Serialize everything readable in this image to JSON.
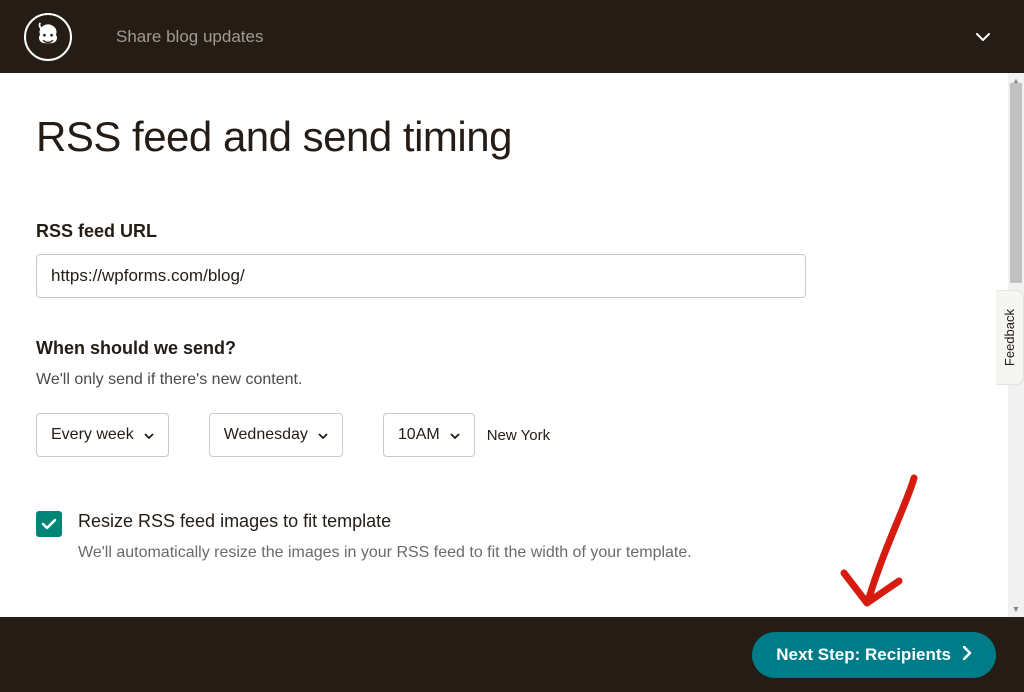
{
  "header": {
    "title": "Share blog updates"
  },
  "page": {
    "heading": "RSS feed and send timing"
  },
  "rss_url": {
    "label": "RSS feed URL",
    "value": "https://wpforms.com/blog/"
  },
  "send_timing": {
    "label": "When should we send?",
    "help": "We'll only send if there's new content.",
    "frequency": "Every week",
    "day": "Wednesday",
    "time": "10AM",
    "timezone": "New York"
  },
  "resize_option": {
    "checked": true,
    "label": "Resize RSS feed images to fit template",
    "help": "We'll automatically resize the images in your RSS feed to fit the width of your template."
  },
  "footer": {
    "next_label": "Next Step: Recipients"
  },
  "feedback": {
    "label": "Feedback"
  }
}
